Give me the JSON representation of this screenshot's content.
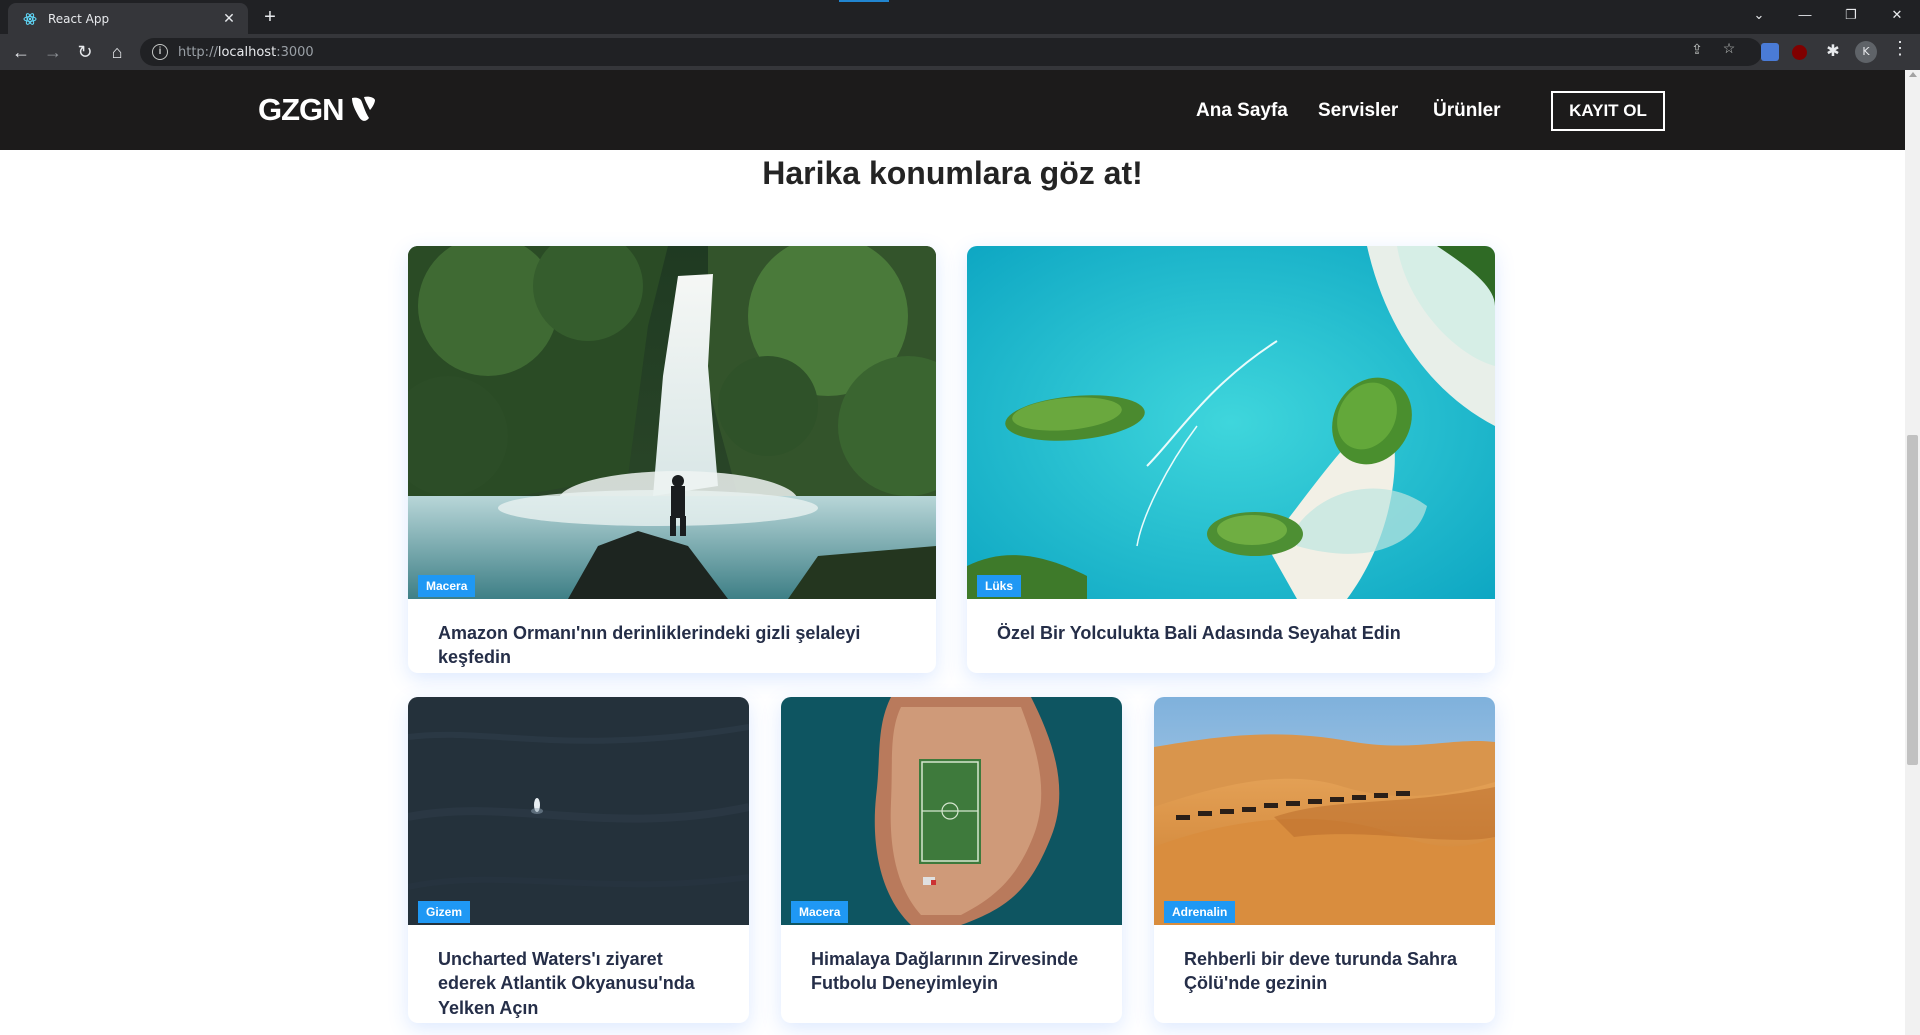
{
  "browser": {
    "tab_title": "React App",
    "url_prefix": "http://",
    "url_host": "localhost",
    "url_port": ":3000",
    "avatar_letter": "K"
  },
  "site": {
    "logo_text": "GZGN",
    "nav": [
      "Ana Sayfa",
      "Servisler",
      "Ürünler"
    ],
    "signup_label": "KAYIT OL"
  },
  "section": {
    "heading": "Harika konumlara göz at!"
  },
  "cards": [
    {
      "label": "Macera",
      "text": "Amazon Ormanı'nın derinliklerindeki gizli şelaleyi keşfedin",
      "image": "waterfall-image"
    },
    {
      "label": "Lüks",
      "text": "Özel Bir Yolculukta Bali Adasında Seyahat Edin",
      "image": "tropical-island-aerial-image"
    },
    {
      "label": "Gizem",
      "text": "Uncharted Waters'ı ziyaret ederek Atlantik Okyanusu'nda Yelken Açın",
      "image": "dark-ocean-boat-image"
    },
    {
      "label": "Macera",
      "text": "Himalaya Dağlarının Zirvesinde Futbolu Deneyimleyin",
      "image": "island-football-field-image"
    },
    {
      "label": "Adrenalin",
      "text": "Rehberli bir deve turunda Sahra Çölü'nde gezinin",
      "image": "desert-camel-caravan-image"
    }
  ],
  "colors": {
    "site_nav_bg": "#1c1b1b",
    "badge_bg": "#1f98f4",
    "card_text": "#252e48"
  }
}
